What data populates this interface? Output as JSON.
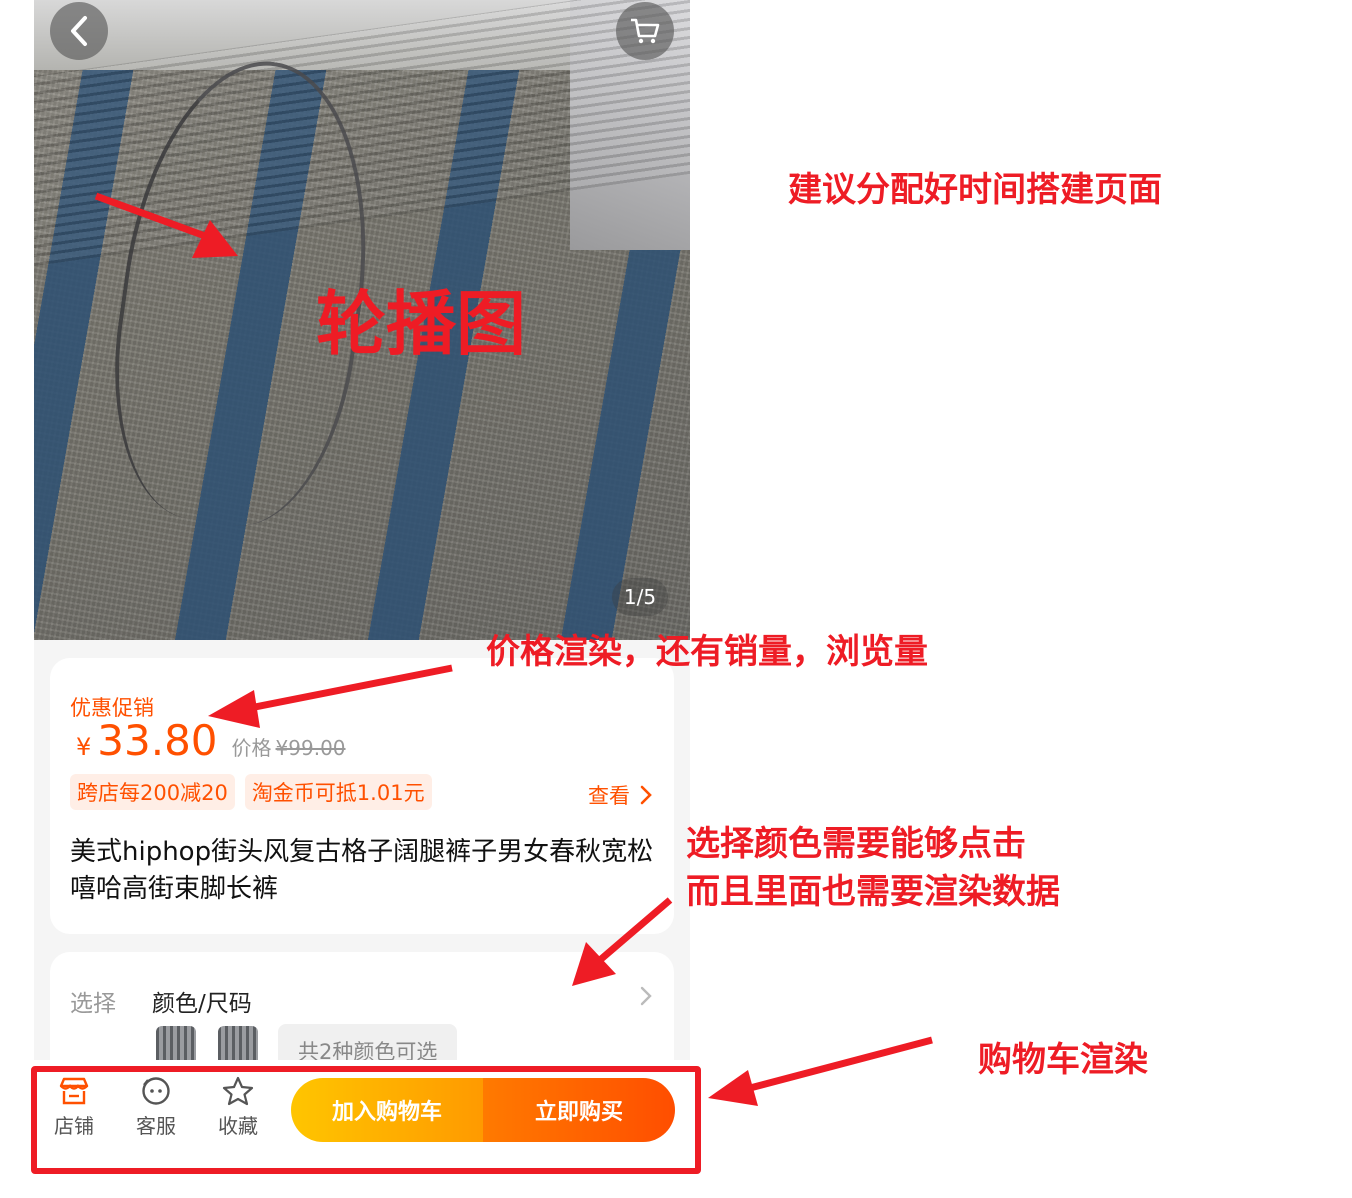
{
  "product": {
    "image_counter": "1/5",
    "promo_label": "优惠促销",
    "currency": "¥",
    "price": "33.80",
    "original_price_label": "价格",
    "original_price": "¥99.00",
    "tags": [
      "跨店每200减20",
      "淘金币可抵1.01元"
    ],
    "view_more": "查看",
    "title": "美式hiphop街头风复古格子阔腿裤子男女春秋宽松嘻哈高街束脚长裤"
  },
  "selection": {
    "label": "选择",
    "value": "颜色/尺码",
    "color_count": "共2种颜色可选"
  },
  "bottom_bar": {
    "store": "店铺",
    "service": "客服",
    "favorite": "收藏",
    "add_to_cart": "加入购物车",
    "buy_now": "立即购买"
  },
  "annotations": {
    "page_note": "建议分配好时间搭建页面",
    "carousel_note": "轮播图",
    "price_note": "价格渲染，还有销量，浏览量",
    "select_note_1": "选择颜色需要能够点击",
    "select_note_2": "而且里面也需要渲染数据",
    "cart_note": "购物车渲染"
  },
  "colors": {
    "accent": "#ff5000",
    "annotation": "#ee1c25",
    "cart_button": "#ffb000",
    "buy_button": "#ff5a00"
  }
}
